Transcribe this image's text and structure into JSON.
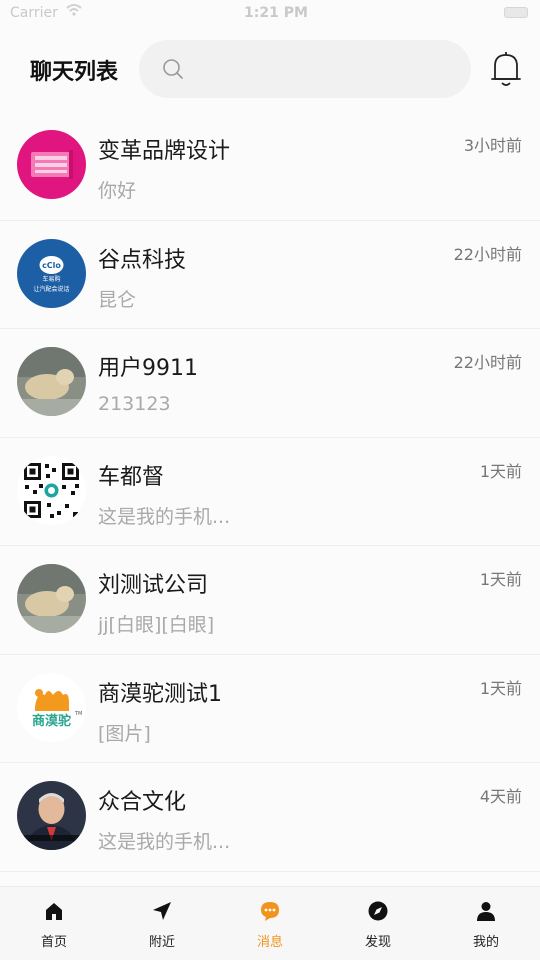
{
  "status_bar": {
    "carrier": "Carrier",
    "time": "1:21 PM"
  },
  "header": {
    "title": "聊天列表",
    "search_placeholder": ""
  },
  "chats": [
    {
      "name": "变革品牌设计",
      "preview": "你好",
      "time": "3小时前"
    },
    {
      "name": "谷点科技",
      "preview": "昆仑",
      "time": "22小时前"
    },
    {
      "name": "用户9911",
      "preview": "213123",
      "time": "22小时前"
    },
    {
      "name": "车都督",
      "preview": "这是我的手机...",
      "time": "1天前"
    },
    {
      "name": "刘测试公司",
      "preview": "jj[白眼][白眼]",
      "time": "1天前"
    },
    {
      "name": "商漠驼测试1",
      "preview": "[图片]",
      "time": "1天前"
    },
    {
      "name": "众合文化",
      "preview": "这是我的手机...",
      "time": "4天前"
    }
  ],
  "avatar_text": {
    "gudian": "让汽配会说话",
    "gudian_brand": "车易购",
    "shangmotuo": "商漠驼",
    "shangmotuo_tm": "TM"
  },
  "tabs": [
    {
      "label": "首页",
      "icon": "home-icon",
      "active": false
    },
    {
      "label": "附近",
      "icon": "location-arrow-icon",
      "active": false
    },
    {
      "label": "消息",
      "icon": "message-icon",
      "active": true
    },
    {
      "label": "发现",
      "icon": "compass-icon",
      "active": false
    },
    {
      "label": "我的",
      "icon": "user-icon",
      "active": false
    }
  ],
  "colors": {
    "accent": "#f1941e",
    "background": "#fbfbfb",
    "preview_text": "#a9a9a9"
  }
}
